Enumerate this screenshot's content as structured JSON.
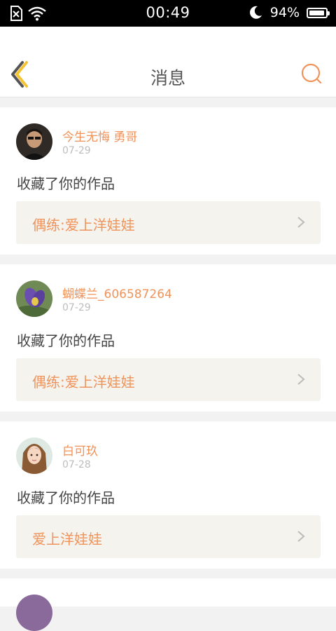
{
  "status_bar": {
    "time": "00:49",
    "battery_percent": "94%",
    "battery_level": 0.94,
    "icons": [
      "sim-off-icon",
      "wifi-icon",
      "moon-icon",
      "battery-icon"
    ]
  },
  "header": {
    "title": "消息",
    "back_icon": "chevron-left-icon",
    "search_icon": "search-icon"
  },
  "colors": {
    "accent": "#f0935a",
    "back_icon": "#f4c431",
    "work_bg": "#f4f3ee"
  },
  "messages": [
    {
      "username": "今生无悔 勇哥",
      "date": "07-29",
      "action": "收藏了你的作品",
      "work_title": "偶练:爱上洋娃娃"
    },
    {
      "username": "蝴蝶兰_606587264",
      "date": "07-29",
      "action": "收藏了你的作品",
      "work_title": "偶练:爱上洋娃娃"
    },
    {
      "username": "白可玖",
      "date": "07-28",
      "action": "收藏了你的作品",
      "work_title": "爱上洋娃娃"
    }
  ]
}
